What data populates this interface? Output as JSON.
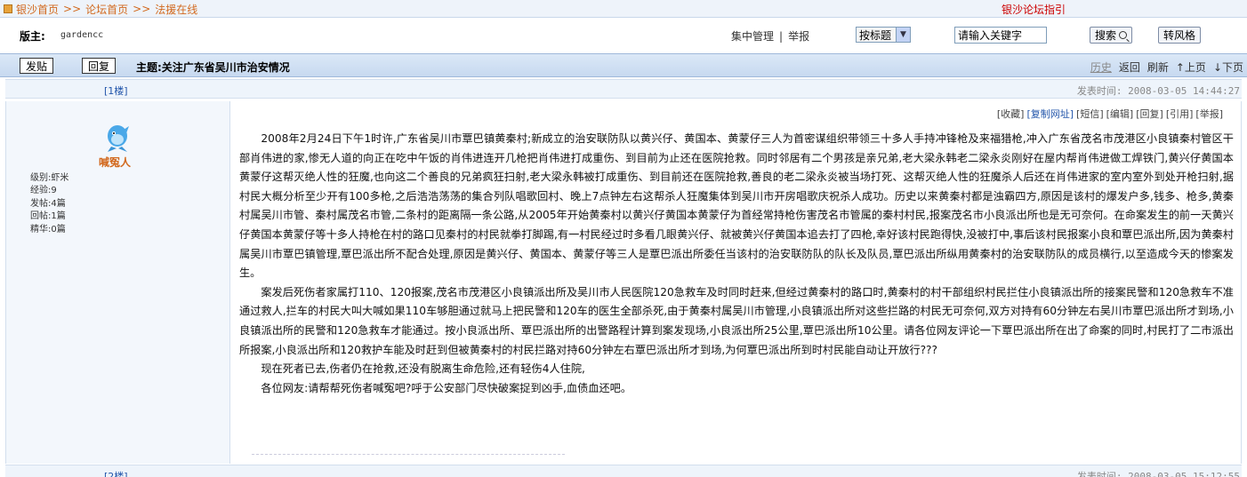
{
  "breadcrumb": {
    "home": "银沙首页",
    "sep": ">>",
    "forum": "论坛首页",
    "board": "法援在线"
  },
  "guide_link": "银沙论坛指引",
  "moderator": {
    "label": "版主:",
    "name": "gardencc"
  },
  "mod_links": {
    "manage": "集中管理",
    "divider": "|",
    "report": "举报"
  },
  "search": {
    "mode": "按标题",
    "keyword_value": "请输入关键字",
    "button": "搜索",
    "style_button": "转风格"
  },
  "toolbar": {
    "post_button": "发贴",
    "reply_button": "回复",
    "topic": "主题:关注广东省吴川市治安情况"
  },
  "topnav": {
    "history": "历史",
    "back": "返回",
    "refresh": "刷新",
    "prev": "↑上页",
    "next": "↓下页"
  },
  "posts": [
    {
      "floor": "[1楼]",
      "time": "发表时间: 2008-03-05 14:44:27",
      "author": "喊冤人",
      "stats": [
        "级别:虾米",
        "经验:9",
        "发帖:4篇",
        "回帖:1篇",
        "精华:0篇"
      ],
      "actions": [
        "[收藏]",
        "[复制网址]",
        "[短信]",
        "[编辑]",
        "[回复]",
        "[引用]",
        "[举报]"
      ],
      "paragraphs": [
        "2008年2月24日下午1时许,广东省吴川市覃巴镇黄秦村;新成立的治安联防队以黄兴仔、黄国本、黄蒙仔三人为首密谋组织带领三十多人手持冲锋枪及来福猎枪,冲入广东省茂名市茂港区小良镇秦村管区干部肖伟进的家,惨无人道的向正在吃中午饭的肖伟进连开几枪把肖伟进打成重伤、到目前为止还在医院抢救。同时邻居有二个男孩是亲兄弟,老大梁永韩老二梁永炎刚好在屋内帮肖伟进做工焊铁门,黄兴仔黄国本黄蒙仔这帮灭绝人性的狂魔,也向这二个善良的兄弟疯狂扫射,老大梁永韩被打成重伤、到目前还在医院抢救,善良的老二梁永炎被当场打死、这帮灭绝人性的狂魔杀人后还在肖伟进家的室内室外到处开枪扫射,据村民大概分析至少开有100多枪,之后浩浩荡荡的集合列队唱歌回村、晚上7点钟左右这帮杀人狂魔集体到吴川市开房唱歌庆祝杀人成功。历史以来黄秦村都是浊霸四方,原因是该村的爆发户多,钱多、枪多,黄秦村属吴川市管、秦村属茂名市管,二条村的距离隔一条公路,从2005年开始黄秦村以黄兴仔黄国本黄蒙仔为首经常持枪伤害茂名市管属的秦村村民,报案茂名市小良派出所也是无可奈何。在命案发生的前一天黄兴仔黄国本黄蒙仔等十多人持枪在村的路口见秦村的村民就拳打脚踢,有一村民经过时多看几眼黄兴仔、就被黄兴仔黄国本追去打了四枪,幸好该村民跑得快,没被打中,事后该村民报案小良和覃巴派出所,因为黄秦村属吴川市覃巴镇管理,覃巴派出所不配合处理,原因是黄兴仔、黄国本、黄蒙仔等三人是覃巴派出所委任当该村的治安联防队的队长及队员,覃巴派出所纵用黄秦村的治安联防队的成员横行,以至造成今天的惨案发生。",
        "案发后死伤者家属打110、120报案,茂名市茂港区小良镇派出所及吴川市人民医院120急救车及时同时赶来,但经过黄秦村的路口时,黄秦村的村干部组织村民拦住小良镇派出所的接案民警和120急救车不准通过救人,拦车的村民大叫大喊如果110车够胆通过就马上把民警和120车的医生全部杀死,由于黄秦村属吴川市管理,小良镇派出所对这些拦路的村民无可奈何,双方对持有60分钟左右吴川市覃巴派出所才到场,小良镇派出所的民警和120急救车才能通过。按小良派出所、覃巴派出所的出警路程计算到案发现场,小良派出所25公里,覃巴派出所10公里。请各位网友评论一下覃巴派出所在出了命案的同时,村民打了二市派出所报案,小良派出所和120救护车能及时赶到但被黄秦村的村民拦路对持60分钟左右覃巴派出所才到场,为何覃巴派出所到时村民能自动让开放行???",
        "现在死者已去,伤者仍在抢救,还没有脱离生命危险,还有轻伤4人住院,",
        "各位网友:请帮帮死伤者喊冤吧?呼于公安部门尽快破案捉到凶手,血债血还吧。"
      ]
    },
    {
      "floor": "[2楼]",
      "time": "发表时间: 2008-03-05 15:12:55"
    }
  ],
  "colors": {
    "accent": "#d2691e",
    "link_blue": "#2255aa",
    "bar_bg": "#c7d9f0"
  }
}
